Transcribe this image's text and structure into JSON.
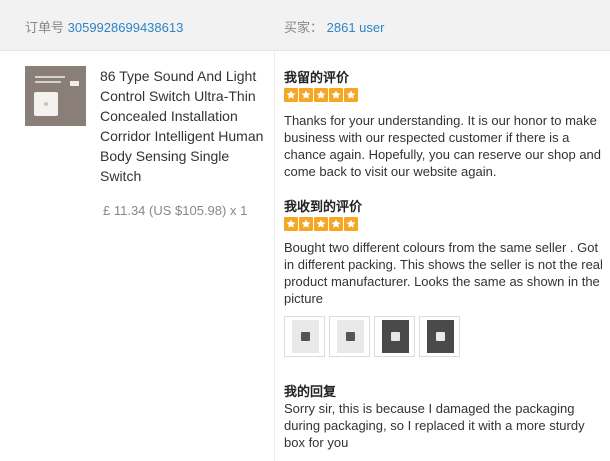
{
  "header": {
    "order_label": "订单号",
    "order_number": "3059928699438613",
    "buyer_label": "买家：",
    "buyer_name": "2861 user"
  },
  "product": {
    "title": "86 Type Sound And Light Control Switch Ultra-Thin Concealed Installation Corridor Intelligent Human Body Sensing Single Switch",
    "price": "£ 11.34 (US $105.98) x 1"
  },
  "my_review": {
    "heading": "我留的评价",
    "rating": 5,
    "text": "Thanks for your understanding. It is our honor to make business with our respected customer if there is a chance again. Hopefully, you can reserve our shop and come back to visit our website again."
  },
  "received_review": {
    "heading": "我收到的评价",
    "rating": 5,
    "text": "Bought two different colours from the same seller . Got in different packing. This shows the seller is not the real product manufacturer. Looks the same as shown in the picture",
    "photo_count": 4
  },
  "my_reply": {
    "heading": "我的回复",
    "text": "Sorry sir, this is because I damaged the packaging during packaging, so I replaced it with a more sturdy box for you"
  },
  "colors": {
    "link": "#2d84c6",
    "star": "#f5a623",
    "header_bg": "#f2f2f2"
  },
  "icons": [
    "star-icon",
    "product-thumbnail",
    "review-photo"
  ]
}
